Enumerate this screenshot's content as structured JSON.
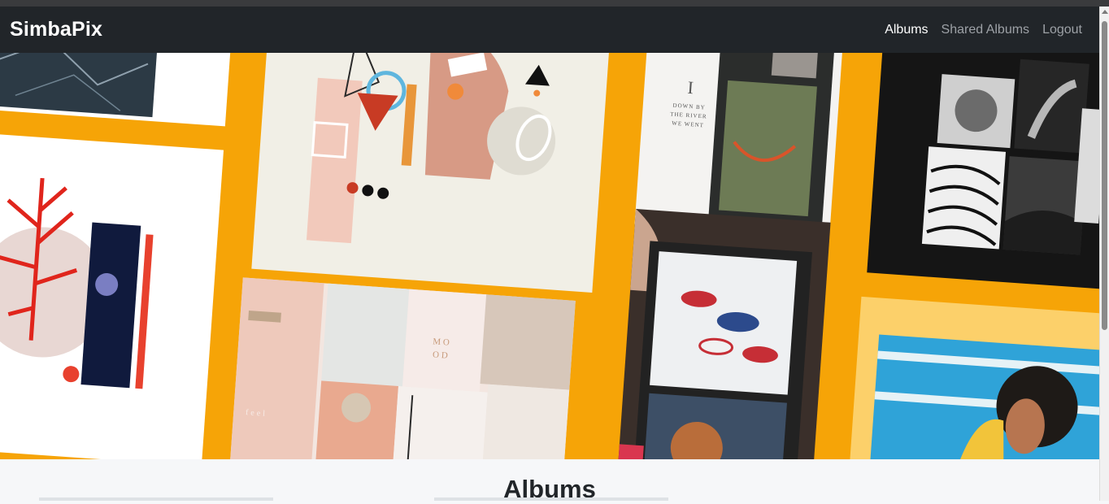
{
  "app": {
    "brand": "SimbaPix"
  },
  "nav": {
    "items": [
      {
        "label": "Albums",
        "active": true
      },
      {
        "label": "Shared Albums",
        "active": false
      },
      {
        "label": "Logout",
        "active": false
      }
    ]
  },
  "hero": {
    "background_color": "#f6a407",
    "tile_texts": {
      "poem_numeral": "I",
      "poem_line1": "DOWN BY",
      "poem_line2": "THE RIVER",
      "poem_line3": "WE WENT",
      "mood_line1": "M O",
      "mood_line2": "O D",
      "feel_text": "feel"
    }
  },
  "main": {
    "section_title": "Albums"
  }
}
